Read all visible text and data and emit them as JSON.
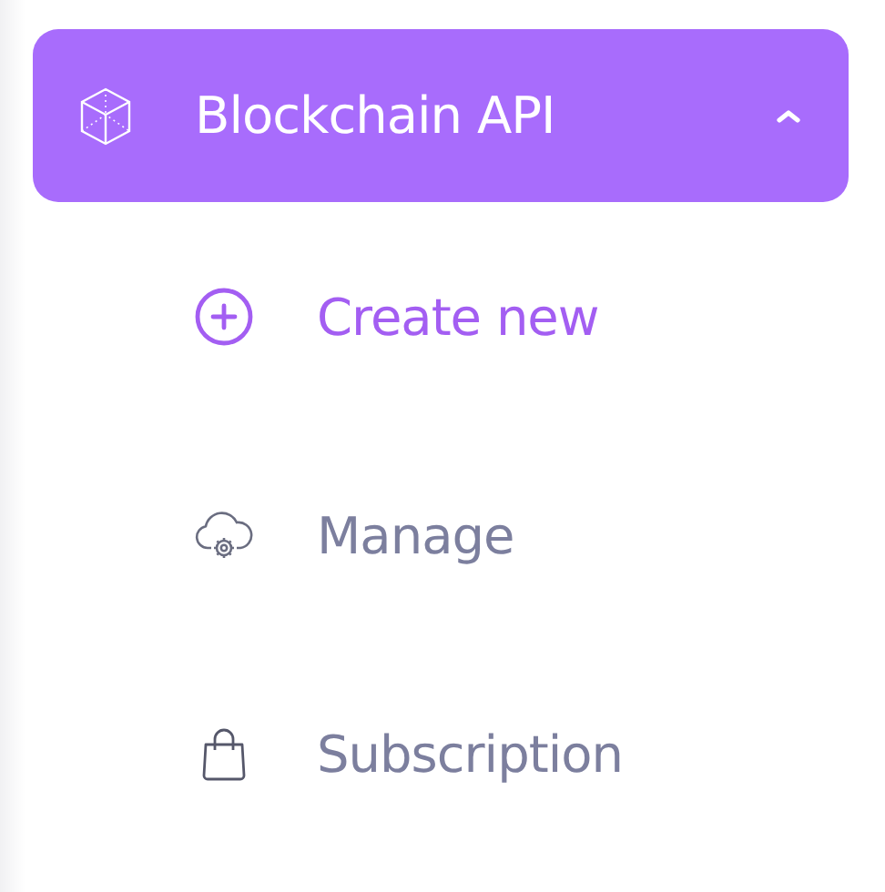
{
  "menu": {
    "label": "Blockchain API",
    "expanded": true,
    "items": [
      {
        "label": "Create new",
        "kind": "create",
        "selected": true
      },
      {
        "label": "Manage",
        "kind": "manage",
        "selected": false
      },
      {
        "label": "Subscription",
        "kind": "subscription",
        "selected": false
      }
    ]
  }
}
